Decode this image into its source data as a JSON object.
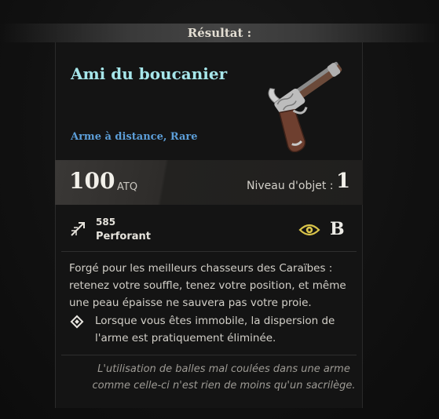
{
  "header": {
    "result_label": "Résultat :"
  },
  "item": {
    "name": "Ami du boucanier",
    "type": "Arme à distance, Rare"
  },
  "stats": {
    "attack_value": "100",
    "attack_label": "ATQ",
    "level_label": "Niveau d'objet :",
    "level_value": "1"
  },
  "damage": {
    "value": "585",
    "type_label": "Perforant",
    "icon": "piercing-arrow-icon"
  },
  "grade": {
    "icon": "eye-icon",
    "value": "B"
  },
  "description": "Forgé pour les meilleurs chasseurs des Caraïbes : retenez votre souffle, tenez votre position, et même une peau épaisse ne sauvera pas votre proie.",
  "perk": "Lorsque vous êtes immobile, la dispersion de l'arme est pratiquement éliminée.",
  "flavor_text": "L'utilisation de balles mal coulées dans une arme comme celle-ci n'est rien de moins qu'un sacrilège.",
  "colors": {
    "name": "#a6e6ea",
    "type": "#5c9ed8",
    "grade_icon": "#d9c44a"
  }
}
